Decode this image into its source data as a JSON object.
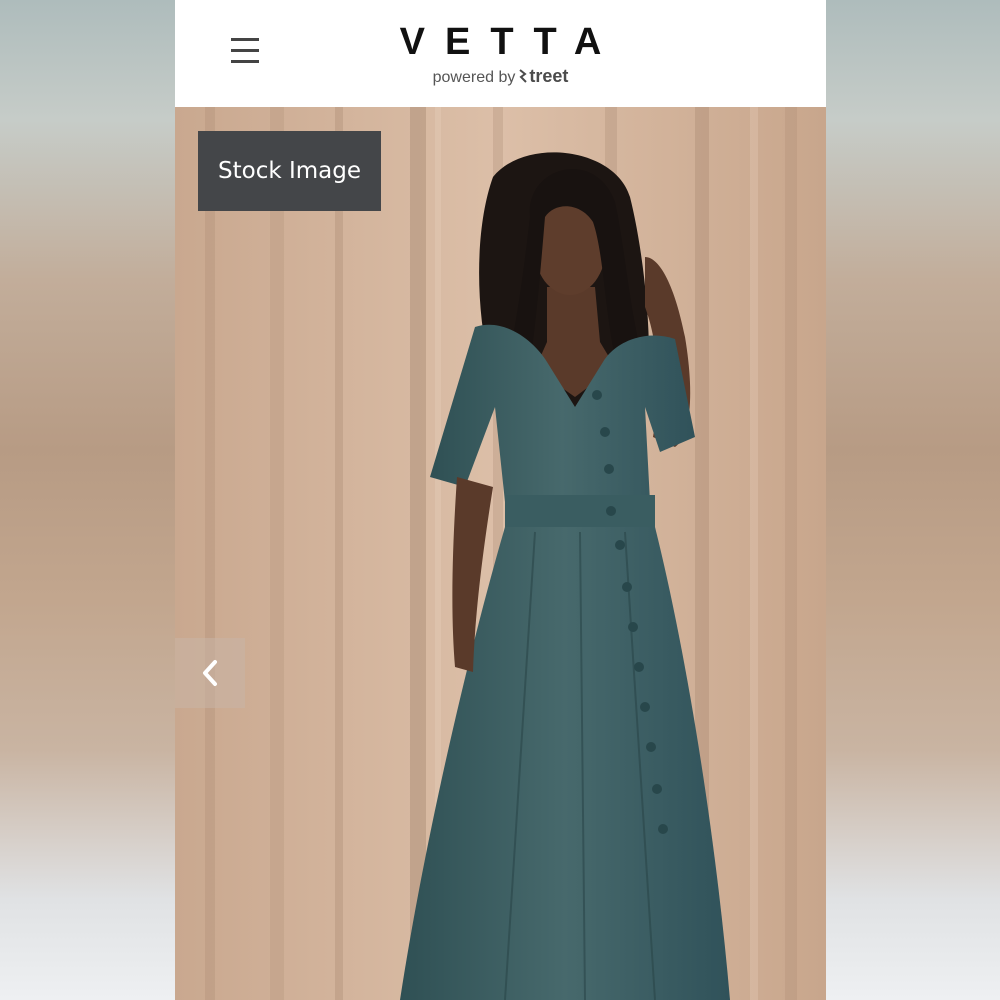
{
  "header": {
    "brand_name": "VETTA",
    "powered_by_prefix": "powered by",
    "powered_by_brand": "treet",
    "menu_icon": "hamburger-menu-icon"
  },
  "gallery": {
    "badge_label": "Stock Image",
    "prev_icon": "chevron-left-icon",
    "image_subject": "green button-front midi dress"
  },
  "colors": {
    "header_bg": "#ffffff",
    "badge_bg": "#444649",
    "dress": "#3f6468",
    "curtain": "#d2b29a"
  }
}
